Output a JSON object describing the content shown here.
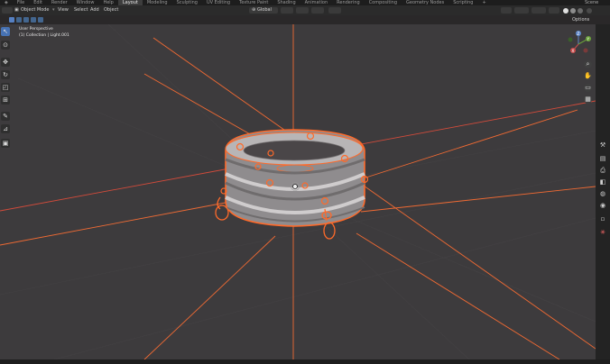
{
  "topbar": {
    "menus": [
      "File",
      "Edit",
      "Render",
      "Window",
      "Help"
    ],
    "workspaces": [
      "Layout",
      "Modeling",
      "Sculpting",
      "UV Editing",
      "Texture Paint",
      "Shading",
      "Animation",
      "Rendering",
      "Compositing",
      "Geometry Nodes",
      "Scripting"
    ],
    "active_workspace": "Layout",
    "add_tab": "+",
    "scene_label": "Scene"
  },
  "header": {
    "mode": "Object Mode",
    "menu_view": "View",
    "menu_select": "Select",
    "menu_add": "Add",
    "menu_object": "Object",
    "transform_orientation": "Global",
    "options": "Options"
  },
  "viewport": {
    "perspective": "User Perspective",
    "collection": "(1) Collection | Light.001"
  },
  "gizmo": {
    "z": "Z",
    "y": "Y",
    "x": "X"
  },
  "colors": {
    "selection": "#ff6a2a",
    "axis_red": "#d34b3b",
    "bg": "#3d3b3d"
  }
}
